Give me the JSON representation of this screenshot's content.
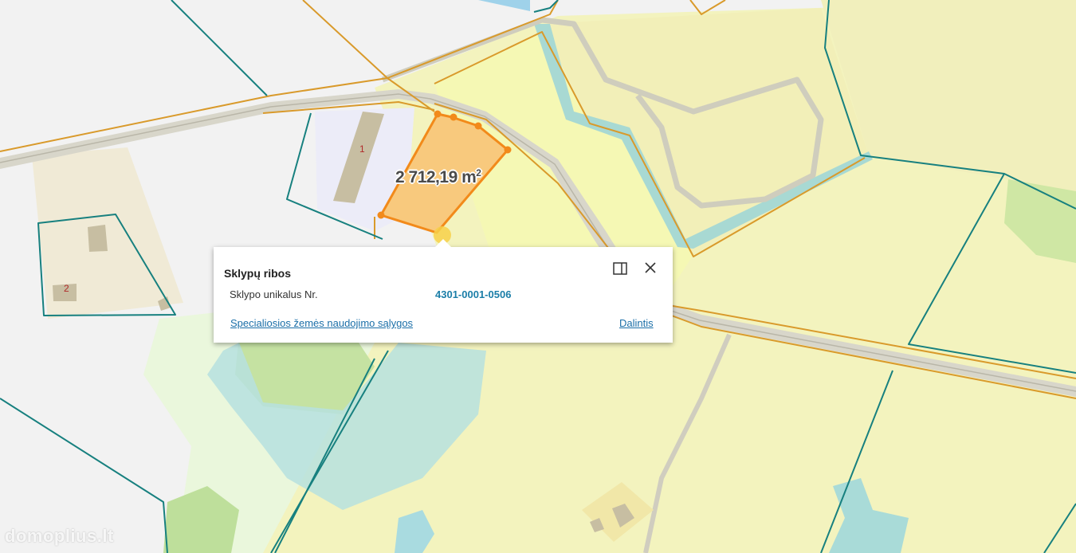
{
  "map": {
    "area_value": "2 712,19 m",
    "area_unit_sup": "2",
    "building_labels": [
      "1",
      "2"
    ],
    "watermark": "domoplius.lt",
    "colors": {
      "background": "#f2f2f2",
      "farmland": "#f4f1c0",
      "farmland_light": "#f3f7bb",
      "field_green": "#c9e3a6",
      "water": "#a8d9e4",
      "water_dots": "#9fd3d9",
      "selected_parcel": "#f7c97a",
      "selected_outline": "#f28a1a",
      "parcel_border_teal": "#17807f",
      "parcel_border_orange": "#d99a2b",
      "road": "#d6d3c6",
      "building": "#c7bda0"
    }
  },
  "popup": {
    "title": "Sklypų ribos",
    "field_label": "Sklypo unikalus Nr.",
    "field_value": "4301-0001-0506",
    "special_link": "Specialiosios žemės naudojimo sąlygos",
    "share_link": "Dalintis"
  }
}
